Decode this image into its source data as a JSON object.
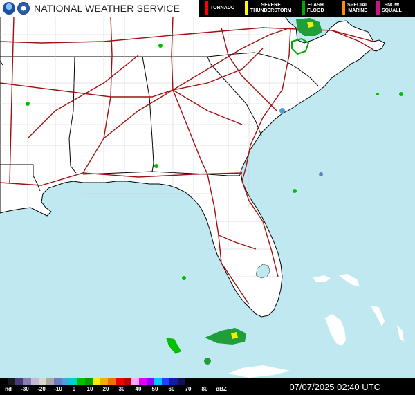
{
  "header": {
    "service_name": "NATIONAL WEATHER SERVICE"
  },
  "legend": [
    {
      "label": "TORNADO",
      "color": "#ff0000"
    },
    {
      "label": "SEVERE\nTHUNDERSTORM",
      "color": "#ffff00"
    },
    {
      "label": "FLASH\nFLOOD",
      "color": "#00aa00"
    },
    {
      "label": "SPECIAL\nMARINE",
      "color": "#ff8c00"
    },
    {
      "label": "SNOW\nSQUALL",
      "color": "#c71585"
    }
  ],
  "scale": {
    "labels": [
      "nd",
      "-30",
      "-20",
      "-10",
      "0",
      "10",
      "20",
      "30",
      "40",
      "50",
      "60",
      "70",
      "80",
      "dBZ"
    ],
    "colors": [
      "#000000",
      "#1a1a1a",
      "#4b3a7a",
      "#8a7ab3",
      "#c8b8d8",
      "#d8d8c8",
      "#a8a8a8",
      "#6a7ac8",
      "#4aa0e0",
      "#00d0d0",
      "#00c000",
      "#00a000",
      "#f0f000",
      "#f0b000",
      "#f07000",
      "#f00000",
      "#c00000",
      "#ffa8ff",
      "#e000ff",
      "#9600ff",
      "#00c8ff",
      "#2040ff",
      "#1818a0",
      "#10105a",
      "#000000",
      "#000000",
      "#000000",
      "#000000",
      "#000000",
      "#000000"
    ]
  },
  "timestamp": "07/07/2025 02:40 UTC",
  "colors": {
    "water": "#bfe8f0",
    "land": "#ffffff",
    "state_border": "#000000",
    "county_border": "#c8c8c8",
    "interstate": "#a01010"
  }
}
